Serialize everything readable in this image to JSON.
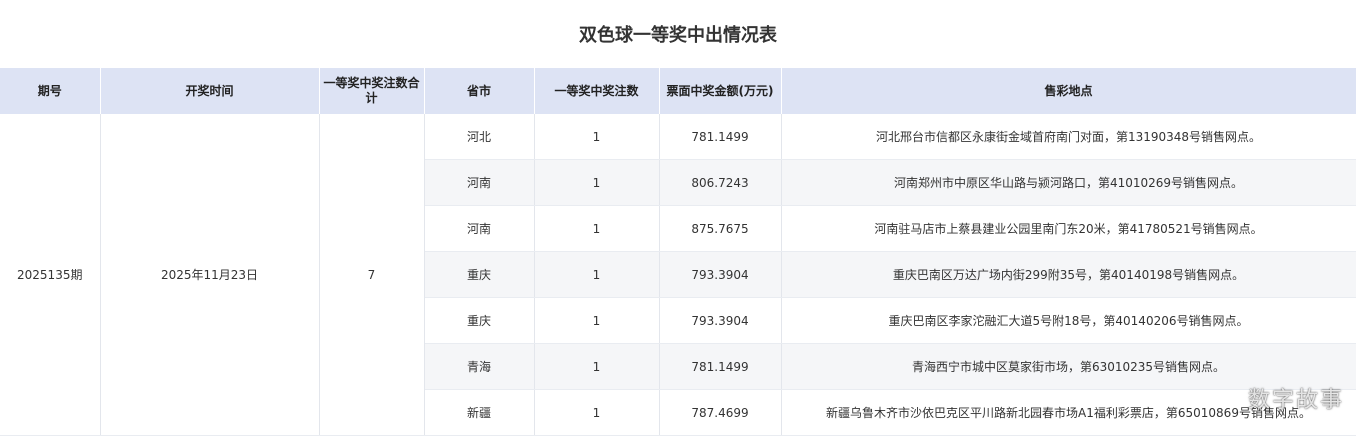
{
  "title": "双色球一等奖中出情况表",
  "headers": {
    "issue": "期号",
    "draw_time": "开奖时间",
    "total": "一等奖中奖注数合计",
    "province": "省市",
    "count": "一等奖中奖注数",
    "amount": "票面中奖金额(万元)",
    "location": "售彩地点"
  },
  "issue": "2025135期",
  "draw_time": "2025年11月23日",
  "total": "7",
  "rows": [
    {
      "province": "河北",
      "count": "1",
      "amount": "781.1499",
      "location": "河北邢台市信都区永康街金域首府南门对面，第13190348号销售网点。"
    },
    {
      "province": "河南",
      "count": "1",
      "amount": "806.7243",
      "location": "河南郑州市中原区华山路与颍河路口，第41010269号销售网点。"
    },
    {
      "province": "河南",
      "count": "1",
      "amount": "875.7675",
      "location": "河南驻马店市上蔡县建业公园里南门东20米，第41780521号销售网点。"
    },
    {
      "province": "重庆",
      "count": "1",
      "amount": "793.3904",
      "location": "重庆巴南区万达广场内街299附35号，第40140198号销售网点。"
    },
    {
      "province": "重庆",
      "count": "1",
      "amount": "793.3904",
      "location": "重庆巴南区李家沱融汇大道5号附18号，第40140206号销售网点。"
    },
    {
      "province": "青海",
      "count": "1",
      "amount": "781.1499",
      "location": "青海西宁市城中区莫家街市场，第63010235号销售网点。"
    },
    {
      "province": "新疆",
      "count": "1",
      "amount": "787.4699",
      "location": "新疆乌鲁木齐市沙依巴克区平川路新北园春市场A1福利彩票店，第65010869号销售网点。"
    }
  ],
  "watermark": "数字故事"
}
